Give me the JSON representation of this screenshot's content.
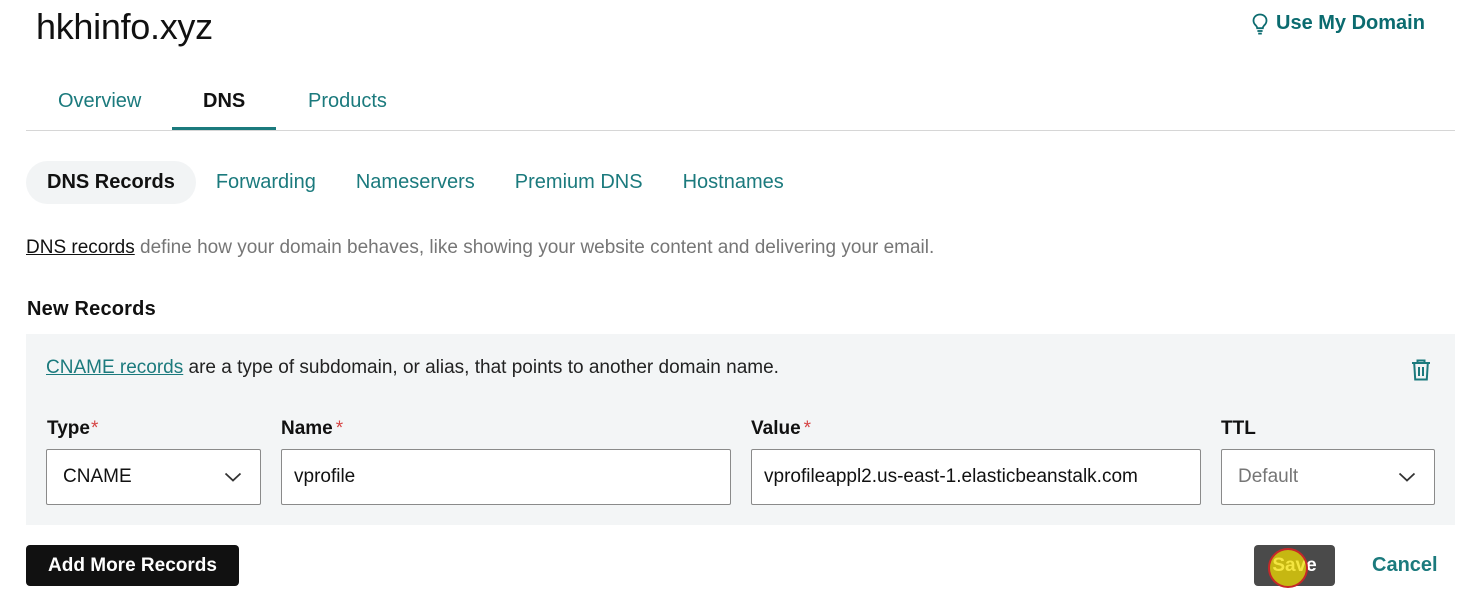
{
  "header": {
    "domain": "hkhinfo.xyz",
    "use_my_domain": "Use My Domain"
  },
  "main_tabs": [
    {
      "label": "Overview",
      "active": false
    },
    {
      "label": "DNS",
      "active": true
    },
    {
      "label": "Products",
      "active": false
    }
  ],
  "sub_tabs": [
    {
      "label": "DNS Records",
      "active": true
    },
    {
      "label": "Forwarding",
      "active": false
    },
    {
      "label": "Nameservers",
      "active": false
    },
    {
      "label": "Premium DNS",
      "active": false
    },
    {
      "label": "Hostnames",
      "active": false
    }
  ],
  "intro": {
    "link": "DNS records",
    "text": " define how your domain behaves, like showing your website content and delivering your email."
  },
  "new_records": {
    "title": "New Records",
    "description_link": "CNAME records",
    "description_text": " are a type of subdomain, or alias, that points to another domain name.",
    "fields": {
      "type_label": "Type",
      "name_label": "Name",
      "value_label": "Value",
      "ttl_label": "TTL",
      "required_mark": "*",
      "type_value": "CNAME",
      "name_value": "vprofile",
      "value_value": "vprofileappl2.us-east-1.elasticbeanstalk.com",
      "ttl_placeholder": "Default"
    }
  },
  "actions": {
    "add_more": "Add More Records",
    "save": "Save",
    "cancel": "Cancel"
  },
  "colors": {
    "accent": "#1b7a7d",
    "required": "#d64545",
    "primary_button": "#111111",
    "save_button": "#4a4a4a"
  },
  "icons": [
    "lightbulb-icon",
    "trash-icon",
    "chevron-down-icon"
  ]
}
